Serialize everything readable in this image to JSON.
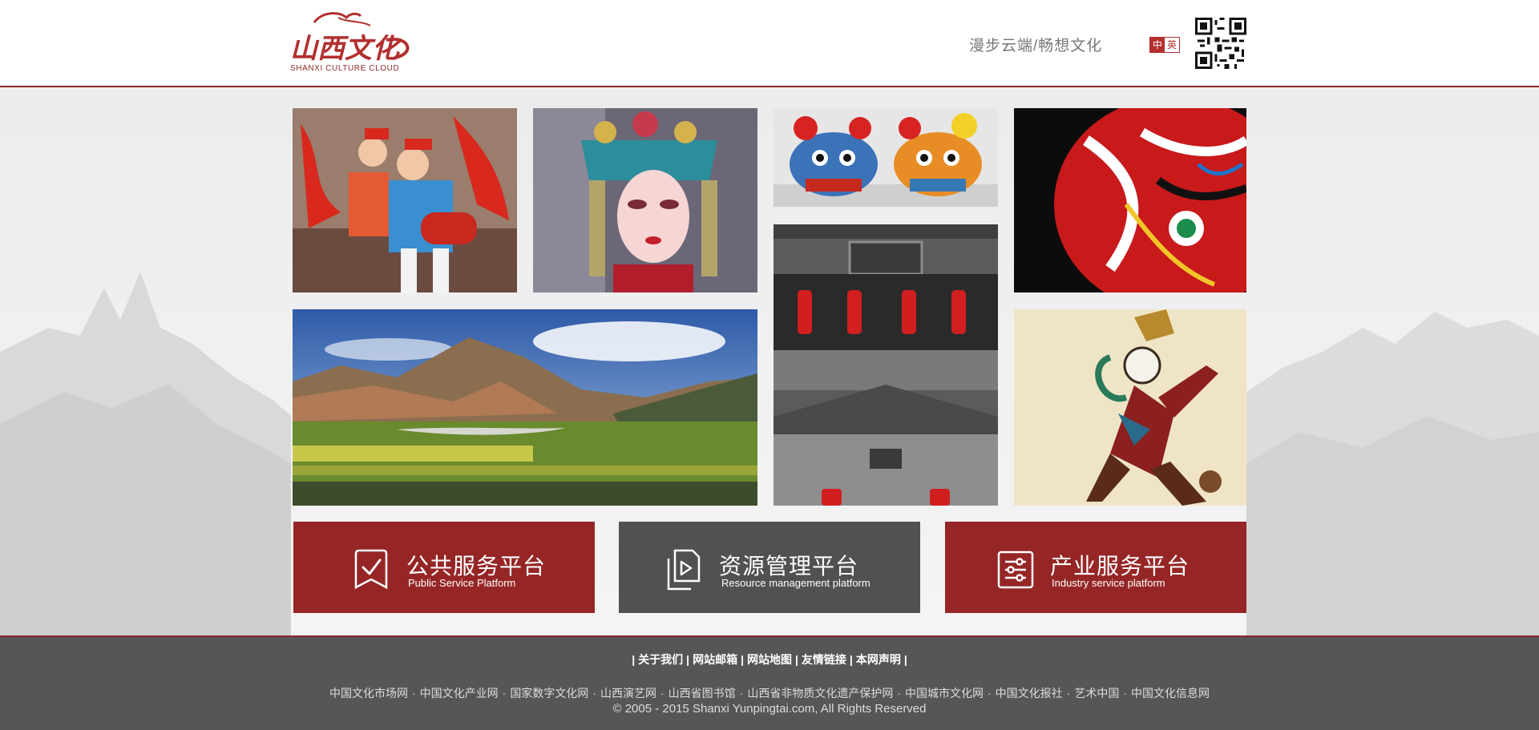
{
  "header": {
    "logo_text": "SHANXI CULTURE CLOUD",
    "slogan": "漫步云端/畅想文化",
    "lang_zh": "中",
    "lang_en": "英"
  },
  "tiles": [
    {
      "name": "yangko-dancers",
      "alt": "Children performing drum dance"
    },
    {
      "name": "opera-actress",
      "alt": "Chinese opera performer"
    },
    {
      "name": "tiger-toys",
      "alt": "Cloth tiger toys"
    },
    {
      "name": "opera-mask",
      "alt": "Painted opera mask"
    },
    {
      "name": "mountain-valley",
      "alt": "Mountain valley landscape"
    },
    {
      "name": "ancient-gate",
      "alt": "Ancient courtyard gate with lanterns"
    },
    {
      "name": "shadow-puppet",
      "alt": "Shadow puppet figure"
    }
  ],
  "platforms": [
    {
      "title": "公共服务平台",
      "subtitle": "Public Service Platform",
      "icon": "checkmark-icon",
      "color": "#962626"
    },
    {
      "title": "资源管理平台",
      "subtitle": "Resource management platform",
      "icon": "play-icon",
      "color": "#515151"
    },
    {
      "title": "产业服务平台",
      "subtitle": "Industry service platform",
      "icon": "sliders-icon",
      "color": "#962626"
    }
  ],
  "footer": {
    "links": [
      "关于我们",
      "网站邮箱",
      "网站地图",
      "友情链接",
      "本网声明"
    ],
    "partners": [
      "中国文化市场网",
      "中国文化产业网",
      "国家数字文化网",
      "山西演艺网",
      "山西省图书馆",
      "山西省非物质文化遗产保护网",
      "中国城市文化网",
      "中国文化报社",
      "艺术中国",
      "中国文化信息网"
    ],
    "copyright": "© 2005 - 2015 Shanxi Yunpingtai.com, All Rights Reserved"
  }
}
